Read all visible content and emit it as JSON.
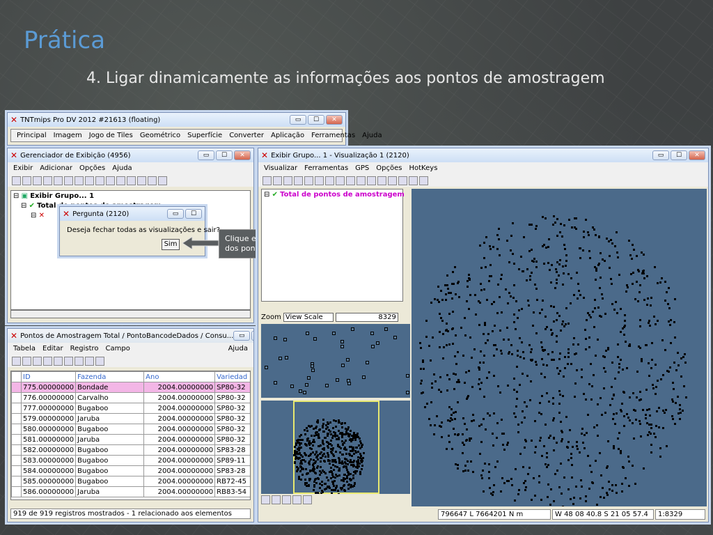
{
  "slide": {
    "title": "Prática",
    "subtitle": "4. Ligar dinamicamente as informações aos pontos de amostragem"
  },
  "main_window": {
    "title": "TNTmips Pro DV 2012  #21613 (floating)",
    "menu": [
      "Principal",
      "Imagem",
      "Jogo de Tiles",
      "Geométrico",
      "Superfície",
      "Converter",
      "Aplicação",
      "Ferramentas",
      "Ajuda"
    ]
  },
  "display_manager": {
    "title": "Gerenciador de Exibição (4956)",
    "menu": [
      "Exibir",
      "Adicionar",
      "Opções",
      "Ajuda"
    ],
    "tree": {
      "group": "Exibir Grupo... 1",
      "layer": "Total de pontos de amostragem"
    }
  },
  "dialog": {
    "title": "Pergunta (2120)",
    "message": "Deseja fechar todas as visualizações e sair?",
    "yes_label": "Sim"
  },
  "callout": {
    "text": "Clique em “Sim” para encerrar a visualização dos pontos de amostragem"
  },
  "table_window": {
    "title": "Pontos de Amostragem Total / PontoBancodeDados / Consu...",
    "menu": [
      "Tabela",
      "Editar",
      "Registro",
      "Campo"
    ],
    "help": "Ajuda",
    "columns": [
      "ID",
      "Fazenda",
      "Ano",
      "Variedad"
    ],
    "rows": [
      [
        "775.00000000",
        "Bondade",
        "2004.00000000",
        "SP80-32"
      ],
      [
        "776.00000000",
        "Carvalho",
        "2004.00000000",
        "SP80-32"
      ],
      [
        "777.00000000",
        "Bugaboo",
        "2004.00000000",
        "SP80-32"
      ],
      [
        "579.00000000",
        "Jaruba",
        "2004.00000000",
        "SP80-32"
      ],
      [
        "580.00000000",
        "Bugaboo",
        "2004.00000000",
        "SP80-32"
      ],
      [
        "581.00000000",
        "Jaruba",
        "2004.00000000",
        "SP80-32"
      ],
      [
        "582.00000000",
        "Bugaboo",
        "2004.00000000",
        "SP83-28"
      ],
      [
        "583.00000000",
        "Bugaboo",
        "2004.00000000",
        "SP89-11"
      ],
      [
        "584.00000000",
        "Bugaboo",
        "2004.00000000",
        "SP83-28"
      ],
      [
        "585.00000000",
        "Bugaboo",
        "2004.00000000",
        "RB72-45"
      ],
      [
        "586.00000000",
        "Jaruba",
        "2004.00000000",
        "RB83-54"
      ]
    ],
    "status": "919 de 919 registros mostrados - 1 relacionado aos elementos"
  },
  "view_window": {
    "title": "Exibir Grupo... 1 - Visualização 1 (2120)",
    "menu": [
      "Visualizar",
      "Ferramentas",
      "GPS",
      "Opções",
      "HotKeys"
    ],
    "legend_layer": "Total de pontos de amostragem",
    "zoom_label": "Zoom",
    "zoom_mode": "View Scale",
    "zoom_value": "8329",
    "status": {
      "coords": "796647 L  7664201 N m",
      "latlon": "W 48 08 40.8  S 21 05 57.4",
      "scale": "1:8329"
    }
  },
  "colors": {
    "map_bg": "#4b6a8a",
    "selected_row": "#f3b6e6",
    "slide_title": "#5b9bd5"
  }
}
